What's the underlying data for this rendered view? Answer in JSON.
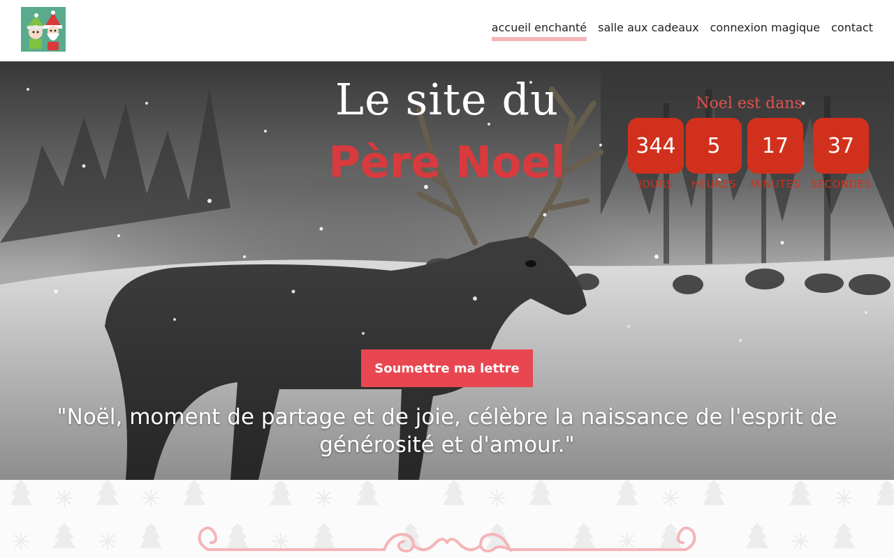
{
  "header": {
    "logo_name": "elf-and-santa-logo",
    "nav": [
      {
        "label": "accueil enchanté",
        "active": true
      },
      {
        "label": "salle aux cadeaux",
        "active": false
      },
      {
        "label": "connexion magique",
        "active": false
      },
      {
        "label": "contact",
        "active": false
      }
    ]
  },
  "hero": {
    "title_line1": "Le site du",
    "title_line2": "Père Noel",
    "countdown": {
      "title": "Noel est dans",
      "items": [
        {
          "value": "344",
          "unit": "JOURS"
        },
        {
          "value": "5",
          "unit": "HEURES"
        },
        {
          "value": "17",
          "unit": "MINUTES"
        },
        {
          "value": "37",
          "unit": "SECONDES"
        }
      ]
    },
    "cta_label": "Soumettre ma lettre",
    "quote": "\"Noël, moment de partage et de joie, célèbre la naissance de l'esprit de générosité et d'amour.\""
  },
  "colors": {
    "accent_red": "#e84651",
    "countdown_red": "#d1311c",
    "title_red": "#d93a3e",
    "nav_underline": "#f4b5b8",
    "logo_bg": "#5aab8d"
  }
}
